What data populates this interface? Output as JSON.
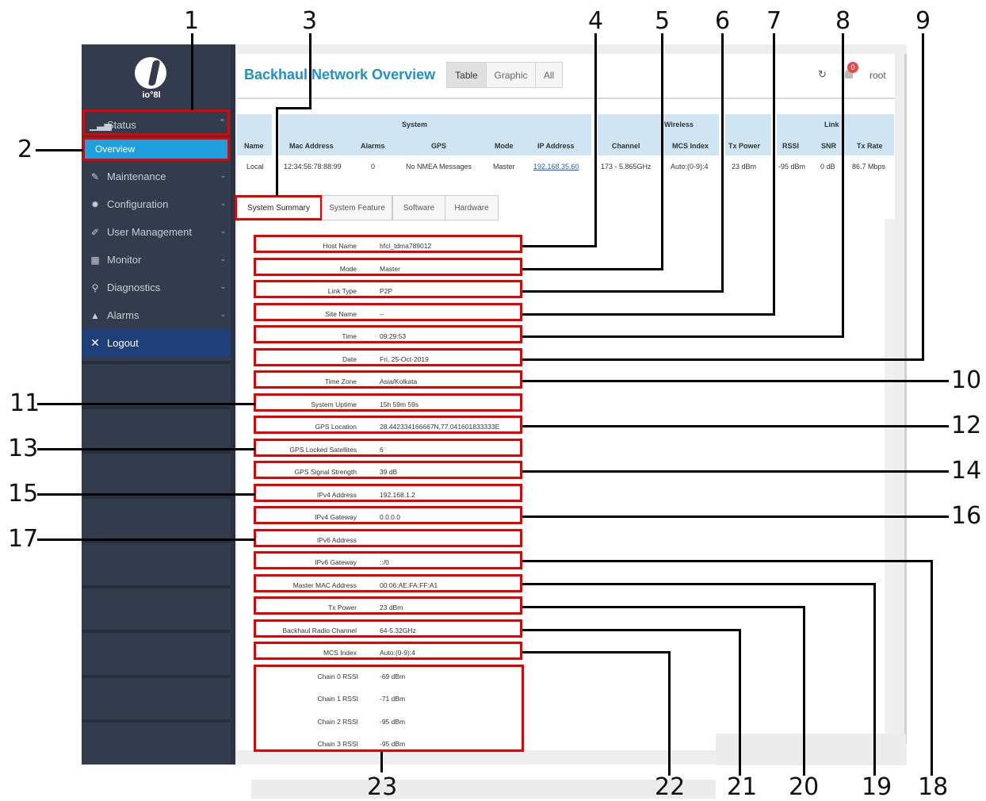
{
  "sidebar": {
    "logo_text": "io°8l",
    "items": [
      {
        "label": "Status",
        "icon": "bar-chart-icon"
      },
      {
        "label": "Overview"
      },
      {
        "label": "Maintenance",
        "icon": "wrench-icon"
      },
      {
        "label": "Configuration",
        "icon": "gear-icon"
      },
      {
        "label": "User Management",
        "icon": "pencil-icon"
      },
      {
        "label": "Monitor",
        "icon": "grid-icon"
      },
      {
        "label": "Diagnostics",
        "icon": "search-icon"
      },
      {
        "label": "Alarms",
        "icon": "bell-icon"
      },
      {
        "label": "Logout",
        "icon": "close-icon"
      }
    ]
  },
  "header": {
    "title": "Backhaul Network Overview",
    "views": [
      "Table",
      "Graphic",
      "All"
    ],
    "notification_count": "0",
    "user": "root"
  },
  "overview_table": {
    "groups": [
      "System",
      "Wireless",
      "Link"
    ],
    "columns": [
      "Name",
      "Mac Address",
      "Alarms",
      "GPS",
      "Mode",
      "IP Address",
      "Channel",
      "MCS Index",
      "Tx Power",
      "RSSI",
      "SNR",
      "Tx Rate"
    ],
    "row": [
      "Local",
      "12:34:56:78:88:99",
      "0",
      "No NMEA Messages",
      "Master",
      "192.168.35.60",
      "173 - 5.865GHz",
      "Auto:(0-9):4",
      "23 dBm",
      "-95 dBm",
      "0 dB",
      "86.7 Mbps"
    ]
  },
  "tabs": [
    "System Summary",
    "System Feature",
    "Software",
    "Hardware"
  ],
  "summary": [
    {
      "label": "Host Name",
      "value": "hfcl_tdma789012"
    },
    {
      "label": "Mode",
      "value": "Master"
    },
    {
      "label": "Link Type",
      "value": "P2P"
    },
    {
      "label": "Site Name",
      "value": "--"
    },
    {
      "label": "Time",
      "value": "09:29:53"
    },
    {
      "label": "Date",
      "value": "Fri, 25-Oct-2019"
    },
    {
      "label": "Time Zone",
      "value": "Asia/Kolkata"
    },
    {
      "label": "System Uptime",
      "value": "15h 59m 59s"
    },
    {
      "label": "GPS Location",
      "value": "28.442334166667N,77.041601833333E"
    },
    {
      "label": "GPS Locked Satellites",
      "value": "6"
    },
    {
      "label": "GPS Signal Strength",
      "value": "39 dB"
    },
    {
      "label": "IPv4 Address",
      "value": "192.168.1.2"
    },
    {
      "label": "IPv4 Gateway",
      "value": "0.0.0.0"
    },
    {
      "label": "IPv6 Address",
      "value": ""
    },
    {
      "label": "IPv6 Gateway",
      "value": "::/0"
    },
    {
      "label": "Master MAC Address",
      "value": "00:06:AE:FA:FF:A1"
    },
    {
      "label": "Tx Power",
      "value": "23 dBm"
    },
    {
      "label": "Backhaul Radio Channel",
      "value": "64-5.32GHz"
    },
    {
      "label": "MCS Index",
      "value": "Auto:(0-9):4"
    }
  ],
  "rssi": [
    {
      "label": "Chain 0 RSSI",
      "value": "-69 dBm"
    },
    {
      "label": "Chain 1 RSSI",
      "value": "-71 dBm"
    },
    {
      "label": "Chain 2 RSSI",
      "value": "-95 dBm"
    },
    {
      "label": "Chain 3 RSSI",
      "value": "-95 dBm"
    }
  ],
  "callouts": [
    "1",
    "2",
    "3",
    "4",
    "5",
    "6",
    "7",
    "8",
    "9",
    "10",
    "11",
    "12",
    "13",
    "14",
    "15",
    "16",
    "17",
    "18",
    "19",
    "20",
    "21",
    "22",
    "23"
  ]
}
